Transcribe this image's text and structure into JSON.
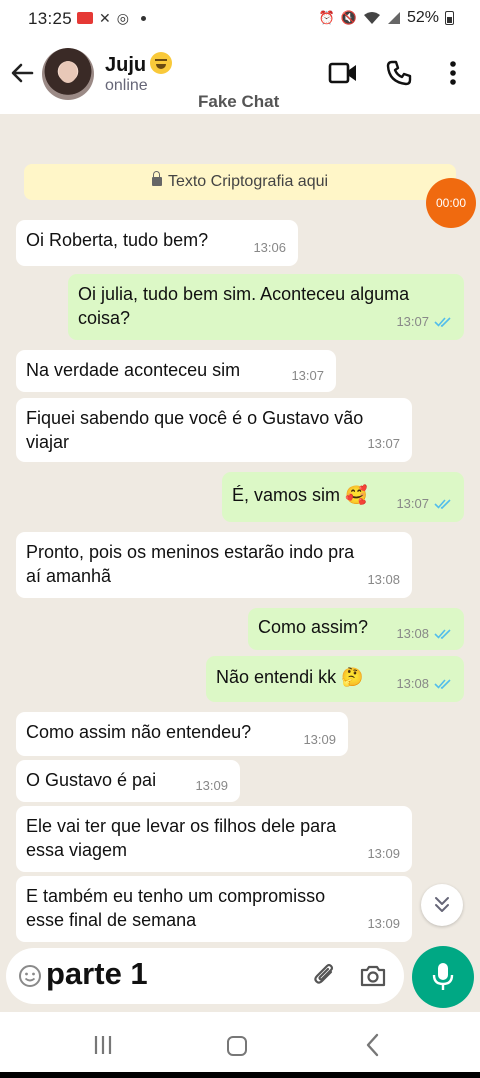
{
  "status_bar": {
    "time": "13:25",
    "battery": "52%"
  },
  "header": {
    "contact_name": "Juju",
    "contact_status": "online",
    "watermark": "Fake Chat"
  },
  "encryption_notice": "Texto Criptografia aqui",
  "timer": "00:00",
  "messages": [
    {
      "direction": "in",
      "lines": [
        "Oi Roberta, tudo bem?"
      ],
      "time": "13:06"
    },
    {
      "direction": "out",
      "lines": [
        "Oi julia, tudo bem sim. Aconteceu alguma",
        "coisa?"
      ],
      "time": "13:07",
      "read": true
    },
    {
      "direction": "in",
      "lines": [
        "Na verdade aconteceu sim"
      ],
      "time": "13:07"
    },
    {
      "direction": "in",
      "lines": [
        "Fiquei sabendo que você é o Gustavo vão",
        "viajar"
      ],
      "time": "13:07"
    },
    {
      "direction": "out",
      "lines": [
        "É, vamos sim 🥰"
      ],
      "time": "13:07",
      "read": true
    },
    {
      "direction": "in",
      "lines": [
        "Pronto, pois os meninos estarão indo pra",
        "aí amanhã"
      ],
      "time": "13:08"
    },
    {
      "direction": "out",
      "lines": [
        "Como assim?"
      ],
      "time": "13:08",
      "read": true
    },
    {
      "direction": "out",
      "lines": [
        "Não entendi kk 🤔"
      ],
      "time": "13:08",
      "read": true
    },
    {
      "direction": "in",
      "lines": [
        "Como assim não entendeu?"
      ],
      "time": "13:09"
    },
    {
      "direction": "in",
      "lines": [
        "O Gustavo é pai"
      ],
      "time": "13:09"
    },
    {
      "direction": "in",
      "lines": [
        "Ele vai ter que levar os filhos dele para",
        "essa viagem"
      ],
      "time": "13:09"
    },
    {
      "direction": "in",
      "lines": [
        "E também eu tenho um compromisso",
        "esse final de semana"
      ],
      "time": "13:09"
    }
  ],
  "input": {
    "text": "parte 1"
  },
  "colors": {
    "incoming_bubble": "#ffffff",
    "outgoing_bubble": "#dcf8c6",
    "chat_background": "#efeae2",
    "accent": "#00a884",
    "read_ticks": "#53bdeb",
    "timer_badge": "#f06a0f"
  },
  "icons": [
    "back-arrow-icon",
    "video-call-icon",
    "voice-call-icon",
    "more-options-icon",
    "lock-icon",
    "double-check-icon",
    "scroll-down-icon",
    "emoji-icon",
    "attach-icon",
    "camera-icon",
    "mic-icon"
  ]
}
